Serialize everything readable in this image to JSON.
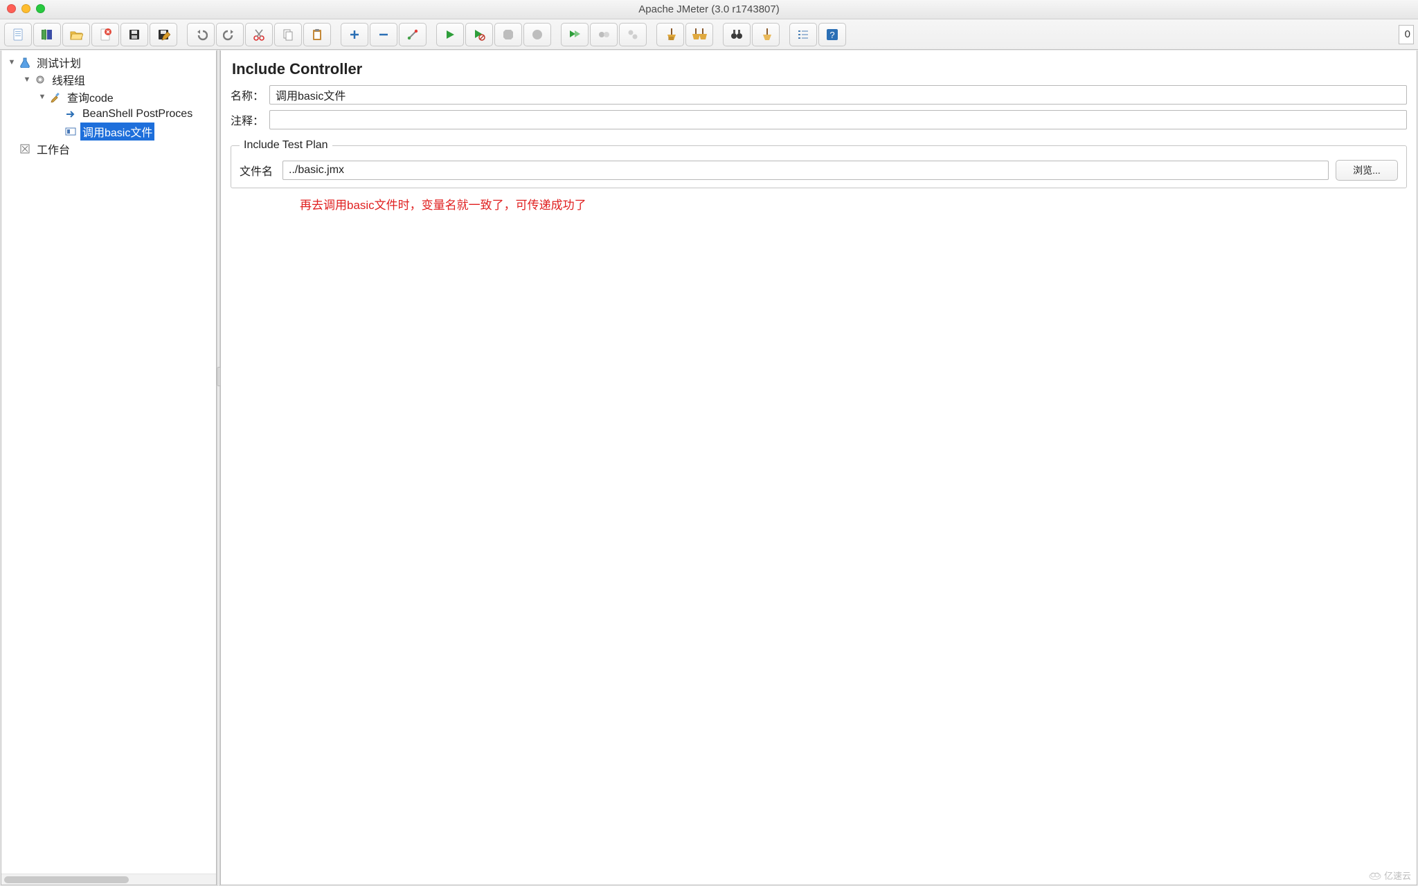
{
  "window": {
    "title": "Apache JMeter (3.0 r1743807)"
  },
  "toolbar": {
    "counter": "0"
  },
  "tree": {
    "testplan": "测试计划",
    "threadgroup": "线程组",
    "query": "查询code",
    "beanshell": "BeanShell PostProces",
    "include": "调用basic文件",
    "workbench": "工作台"
  },
  "editor": {
    "title": "Include Controller",
    "name_label": "名称：",
    "name_value": "调用basic文件",
    "comment_label": "注释：",
    "comment_value": "",
    "fieldset_legend": "Include Test Plan",
    "file_label": "文件名",
    "file_value": "../basic.jmx",
    "browse_label": "浏览...",
    "annotation": "再去调用basic文件时，变量名就一致了，可传递成功了"
  },
  "watermark": "亿速云"
}
